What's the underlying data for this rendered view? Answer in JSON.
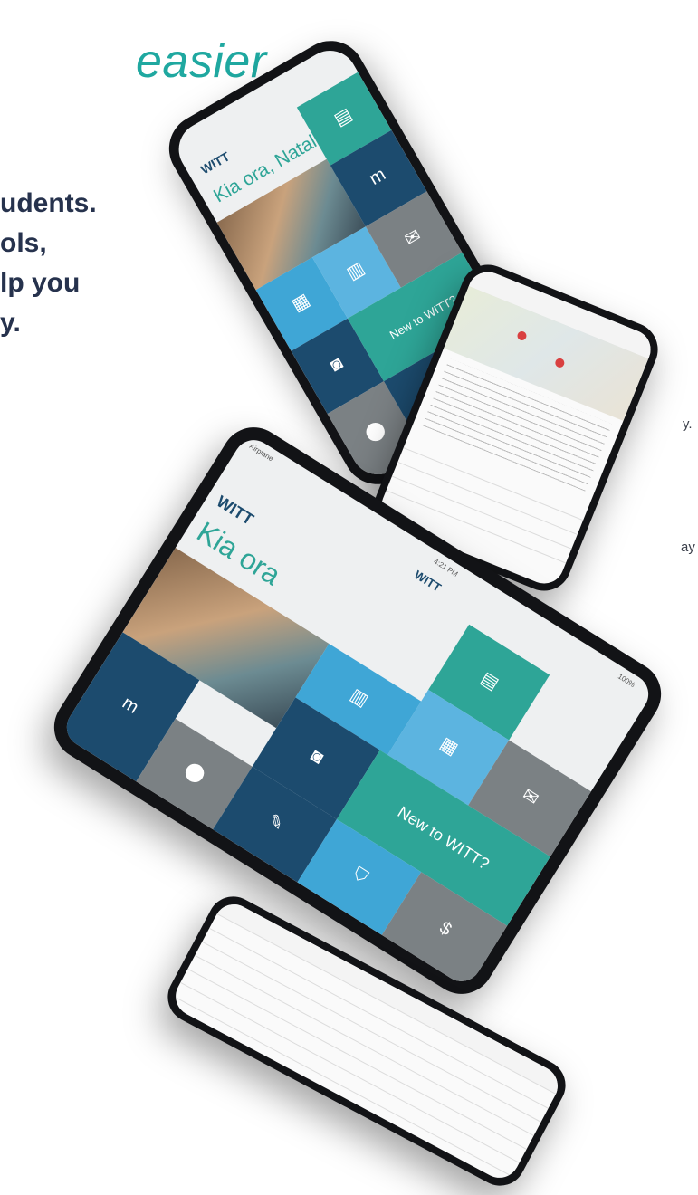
{
  "left": {
    "headline": "easier",
    "lead": "udents.\nols,\nlp you\ny.",
    "fragment1": "y.",
    "fragment2": "ay"
  },
  "phone_top": {
    "app_name": "WITT",
    "greeting": "Kia ora, Natalie",
    "new_tile": "New to WITT?"
  },
  "tablet": {
    "carrier": "Airplane",
    "time": "4:21 PM",
    "battery": "100%",
    "app_name": "WITT",
    "greeting": "Kia ora",
    "new_tile": "New to WITT?"
  },
  "colors": {
    "teal": "#2ea597",
    "navy": "#1c4b6e",
    "blue": "#3fa6d6",
    "grey": "#7b8184",
    "headline": "#1fa8a0"
  }
}
